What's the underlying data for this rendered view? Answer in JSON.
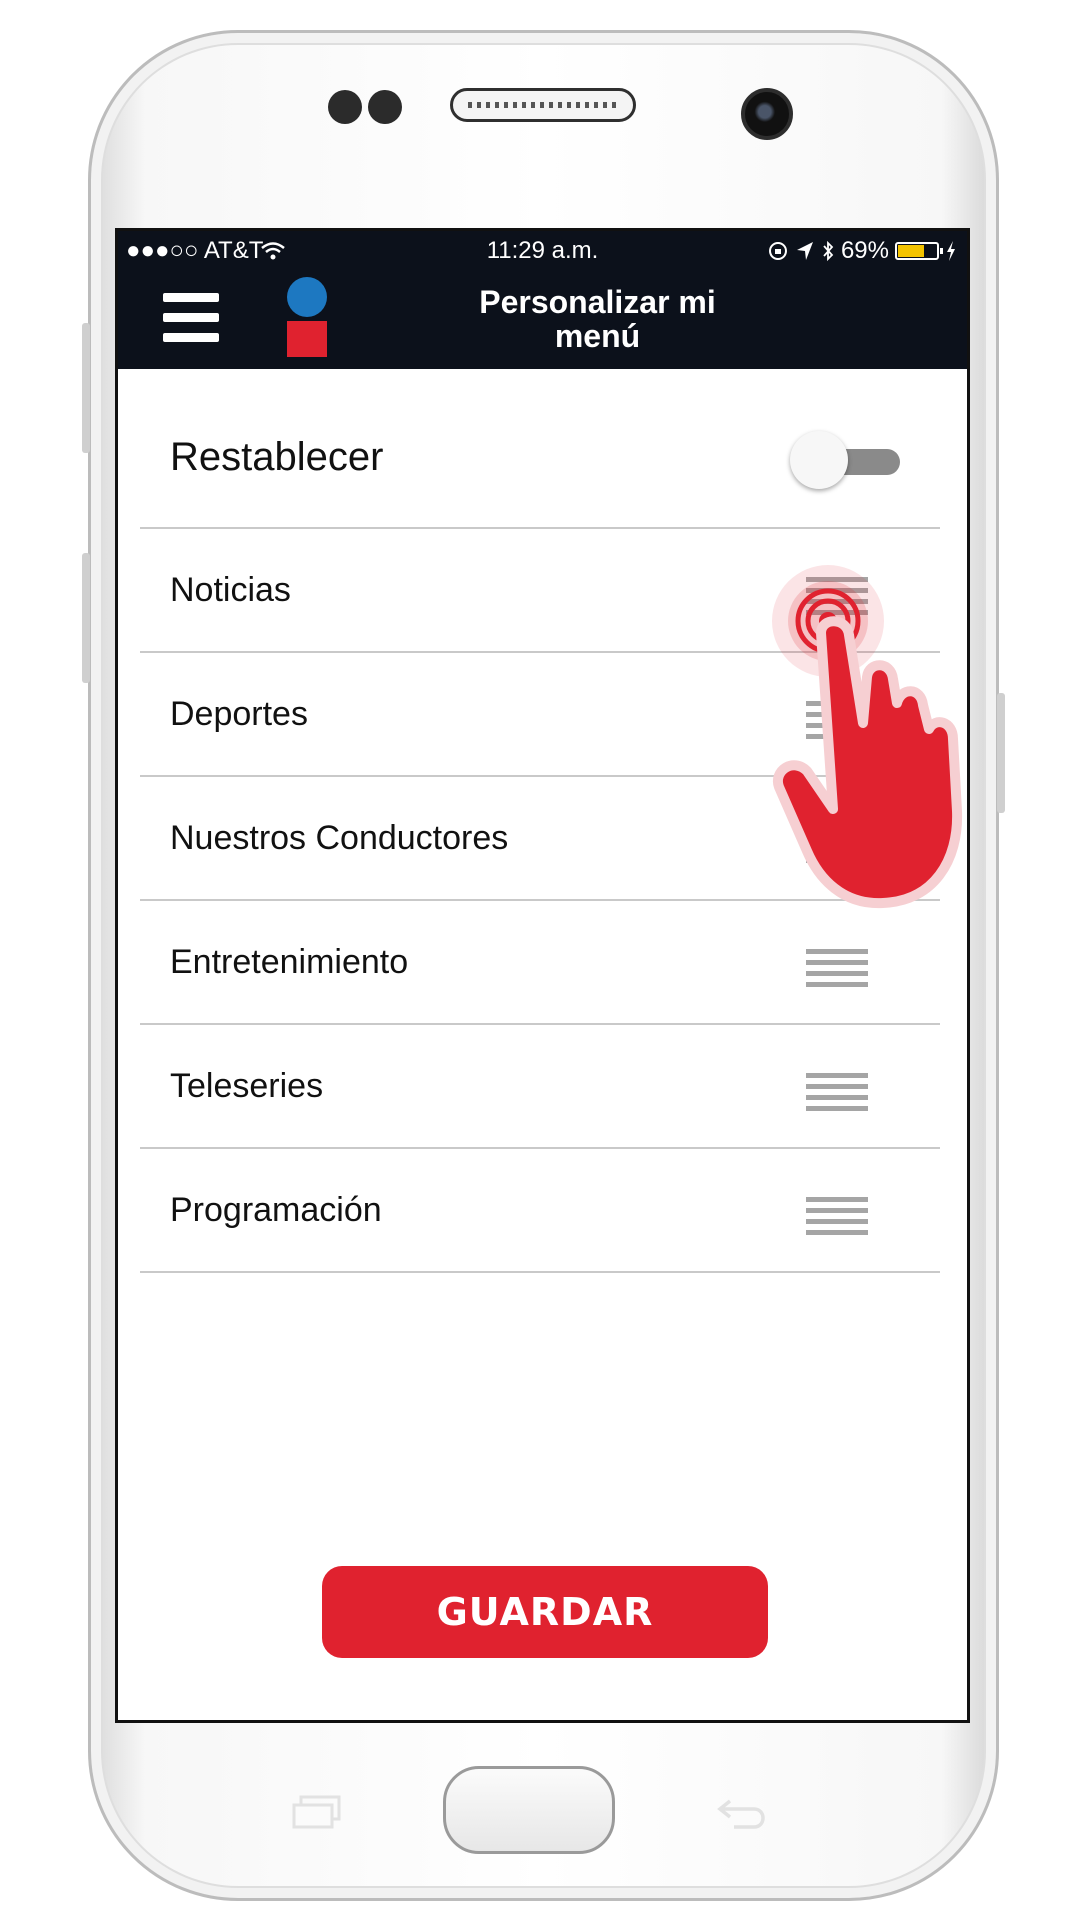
{
  "status_bar": {
    "carrier": "●●●○○ AT&T",
    "time": "11:29 a.m.",
    "battery_percent": "69%",
    "battery_level": 0.69,
    "icons": [
      "signal-dots-icon",
      "wifi-icon",
      "rotation-lock-icon",
      "location-arrow-icon",
      "bluetooth-icon",
      "battery-icon",
      "charging-bolt-icon"
    ]
  },
  "header": {
    "menu_icon": "hamburger-icon",
    "logo_colors": {
      "circle": "#1d78c1",
      "square": "#e0222f"
    },
    "title_line1": "Personalizar mi",
    "title_line2": "menú"
  },
  "reset": {
    "label": "Restablecer",
    "toggle_on": false
  },
  "menu_items": [
    {
      "label": "Noticias"
    },
    {
      "label": "Deportes"
    },
    {
      "label": "Nuestros Conductores"
    },
    {
      "label": "Entretenimiento"
    },
    {
      "label": "Teleseries"
    },
    {
      "label": "Programación"
    }
  ],
  "save_button": {
    "label": "GUARDAR"
  },
  "colors": {
    "header_bg": "#0c111b",
    "accent_red": "#e0222f",
    "brand_blue": "#1d78c1",
    "divider": "#c9c9c9"
  },
  "gesture": {
    "icon": "tap-hand-icon"
  },
  "device_keys": [
    "recent-apps-icon",
    "home-button",
    "back-icon"
  ]
}
